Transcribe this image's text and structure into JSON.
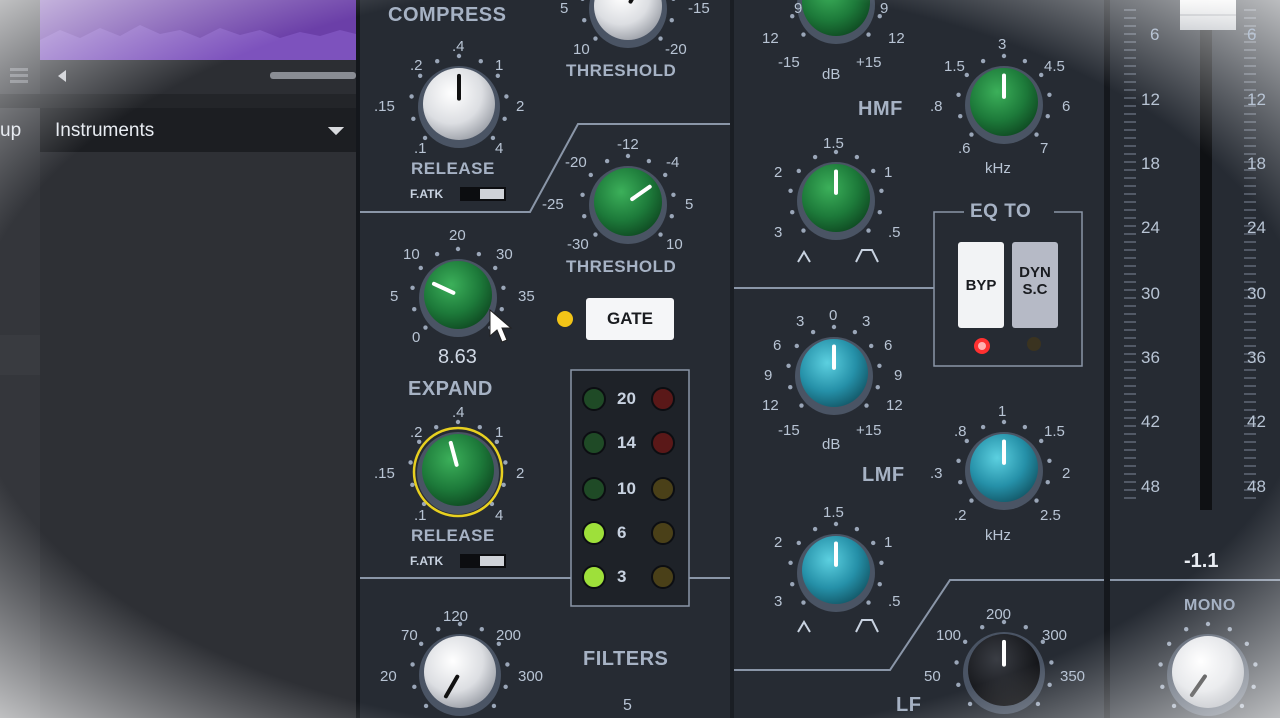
{
  "host": {
    "left_partial_label": "up",
    "dropdown_value": "Instruments"
  },
  "dynamics": {
    "compress_title": "COMPRESS",
    "compress_threshold": {
      "label": "THRESHOLD",
      "ticks": [
        "5",
        "-15",
        "10",
        "-20"
      ]
    },
    "compress_release": {
      "label": "RELEASE",
      "ticks": [
        ".4",
        ".2",
        "1",
        ".15",
        "2",
        ".1",
        "4"
      ],
      "fatk": "F.ATK"
    },
    "gate_threshold": {
      "label": "THRESHOLD",
      "ticks": [
        "-12",
        "-20",
        "-4",
        "-25",
        "5",
        "-30",
        "10"
      ]
    },
    "expand_range": {
      "ticks": [
        "20",
        "10",
        "30",
        "5",
        "35",
        "0"
      ],
      "value": "8.63"
    },
    "gate_button": "GATE",
    "expand_title": "EXPAND",
    "expand_release": {
      "label": "RELEASE",
      "ticks": [
        ".4",
        ".2",
        "1",
        ".15",
        "2",
        ".1",
        "4"
      ],
      "fatk": "F.ATK"
    },
    "meter_labels": [
      "20",
      "14",
      "10",
      "6",
      "3"
    ]
  },
  "eq": {
    "top_gain_ticks": [
      "9",
      "9",
      "12",
      "12",
      "-15",
      "dB",
      "+15"
    ],
    "hmf_title": "HMF",
    "hmf_freq": {
      "ticks": [
        "3",
        "1.5",
        "4.5",
        ".8",
        "6",
        ".6",
        "7"
      ],
      "unit": "kHz"
    },
    "hmf_q": {
      "ticks": [
        "1.5",
        "2",
        "1",
        "3",
        ".5"
      ]
    },
    "eq_to_title": "EQ TO",
    "byp_label": "BYP",
    "dyn_sc_label": [
      "DYN",
      "S.C"
    ],
    "lmf_gain": {
      "ticks": [
        "0",
        "3",
        "3",
        "6",
        "6",
        "9",
        "9",
        "12",
        "12",
        "-15",
        "dB",
        "+15"
      ]
    },
    "lmf_title": "LMF",
    "lmf_freq": {
      "ticks": [
        "1",
        ".8",
        "1.5",
        ".3",
        "2",
        ".2",
        "2.5"
      ],
      "unit": "kHz"
    },
    "lmf_q": {
      "ticks": [
        "1.5",
        "2",
        "1",
        "3",
        ".5"
      ]
    },
    "lf_freq": {
      "ticks": [
        "200",
        "100",
        "300",
        "50",
        "350"
      ]
    },
    "lf_partial": "LF"
  },
  "filters": {
    "title": "FILTERS",
    "hpf_ticks": [
      "120",
      "70",
      "200",
      "20",
      "300"
    ],
    "partial_five": "5"
  },
  "fader": {
    "scale_left": [
      "6",
      "12",
      "18",
      "24",
      "30",
      "36",
      "42",
      "48"
    ],
    "scale_right": [
      "6",
      "12",
      "18",
      "24",
      "30",
      "36",
      "42",
      "48"
    ],
    "value": "-1.1",
    "mono_label": "MONO"
  },
  "colors": {
    "panel": "#262b33",
    "green_knob": "#1d7a3a",
    "blue_knob": "#2b9bb0",
    "white_knob": "#e2e4e8",
    "purple_waveform": "#6b3fa8",
    "led_yellow": "#f2c417",
    "led_red": "#ff3030"
  }
}
